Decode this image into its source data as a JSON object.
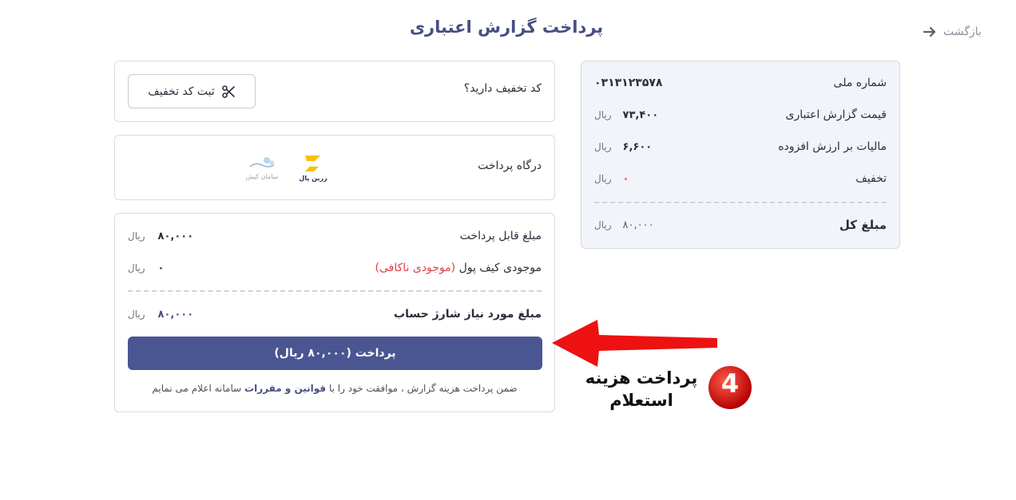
{
  "header": {
    "back_label": "بازگشت",
    "title": "پرداخت گزارش اعتباری"
  },
  "summary": {
    "rows": [
      {
        "label": "شماره ملی",
        "value": "۰۳۱۳۱۲۳۵۷۸",
        "unit": ""
      },
      {
        "label": "قیمت گزارش اعتباری",
        "value": "۷۳,۴۰۰",
        "unit": "ریال"
      },
      {
        "label": "مالیات بر ارزش افزوده",
        "value": "۶,۶۰۰",
        "unit": "ریال"
      },
      {
        "label": "تخفیف",
        "value": "۰",
        "unit": "ریال"
      }
    ],
    "total": {
      "label": "مبلغ کل",
      "value": "۸۰,۰۰۰",
      "unit": "ریال"
    }
  },
  "discount": {
    "question": "کد تخفیف دارید؟",
    "button_label": "ثبت کد تخفیف"
  },
  "gateway": {
    "label": "درگاه پرداخت",
    "options": [
      {
        "name": "زرین پال",
        "icon": "zarinpal-logo"
      },
      {
        "name": "سامان کیش",
        "icon": "saman-kish-logo"
      }
    ]
  },
  "payment": {
    "payable_label": "مبلغ قابل پرداخت",
    "payable_value": "۸۰,۰۰۰",
    "wallet_label": "موجودی کیف پول",
    "wallet_status": "(موجودی ناکافی)",
    "wallet_value": "۰",
    "charge_label": "مبلغ مورد نیاز شارژ حساب",
    "charge_value": "۸۰,۰۰۰",
    "unit": "ریال",
    "button_label": "پرداخت (۸۰,۰۰۰ ریال)",
    "terms_prefix": "ضمن پرداخت هزینه گزارش ، موافقت خود را با",
    "terms_link": "قوانین و مقررات",
    "terms_suffix": "سامانه اعلام می نمایم"
  },
  "annotation": {
    "step_number": "4",
    "line1": "پرداخت هزینه",
    "line2": "استعلام"
  },
  "colors": {
    "primary": "#4a5692",
    "title": "#474f82",
    "danger": "#e0404a",
    "summary_bg": "#f1f4f9",
    "annotation_red": "#e01010"
  }
}
